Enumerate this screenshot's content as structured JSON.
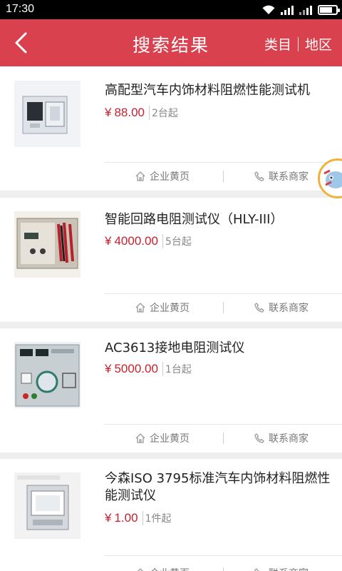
{
  "status_bar": {
    "time": "17:30"
  },
  "header": {
    "title": "搜索结果",
    "category_label": "类目",
    "region_label": "地区"
  },
  "currency_symbol": "¥",
  "action_labels": {
    "yellow_pages": "企业黄页",
    "contact": "联系商家"
  },
  "products": [
    {
      "name": "高配型汽车内饰材料阻燃性能测试机",
      "price": "88.00",
      "moq": "2台起"
    },
    {
      "name": "智能回路电阻测试仪（HLY-III）",
      "price": "4000.00",
      "moq": "5台起"
    },
    {
      "name": "AC3613接地电阻测试仪",
      "price": "5000.00",
      "moq": "1台起"
    },
    {
      "name": "今森ISO 3795标准汽车内饰材料阻燃性能测试仪",
      "price": "1.00",
      "moq": "1件起"
    }
  ],
  "colors": {
    "brand_red": "#d9414e",
    "price_red": "#c8202d",
    "background": "#eeeeee"
  }
}
